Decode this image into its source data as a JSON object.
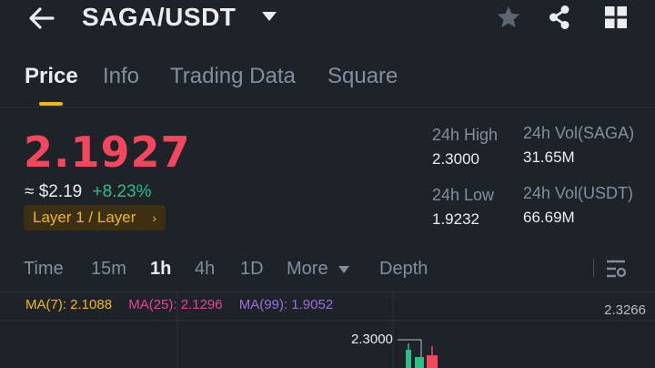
{
  "header": {
    "pair": "SAGA/USDT"
  },
  "tabs": [
    {
      "label": "Price",
      "active": true
    },
    {
      "label": "Info",
      "active": false
    },
    {
      "label": "Trading Data",
      "active": false
    },
    {
      "label": "Square",
      "active": false
    }
  ],
  "ticker": {
    "last_price": "2.1927",
    "usd_price": "≈ $2.19",
    "change_pct": "+8.23%",
    "tag": "Layer 1 / Layer",
    "tag_arrow": "›"
  },
  "stats": {
    "high_label": "24h High",
    "high_value": "2.3000",
    "low_label": "24h Low",
    "low_value": "1.9232",
    "vol_base_label": "24h Vol(SAGA)",
    "vol_base_value": "31.65M",
    "vol_quote_label": "24h Vol(USDT)",
    "vol_quote_value": "66.69M"
  },
  "intervals": [
    {
      "label": "Time",
      "active": false
    },
    {
      "label": "15m",
      "active": false
    },
    {
      "label": "1h",
      "active": true
    },
    {
      "label": "4h",
      "active": false
    },
    {
      "label": "1D",
      "active": false
    },
    {
      "label": "More",
      "active": false
    },
    {
      "label": "Depth",
      "active": false
    }
  ],
  "indicators": {
    "ma7": "MA(7): 2.1088",
    "ma25": "MA(25): 2.1296",
    "ma99": "MA(99): 1.9052"
  },
  "chart": {
    "axis_top_label": "2.3266",
    "high_marker_label": "2.3000"
  },
  "colors": {
    "background": "#1e2329",
    "accent": "#f0b90b",
    "down": "#f6465d",
    "up": "#2ebd85"
  }
}
